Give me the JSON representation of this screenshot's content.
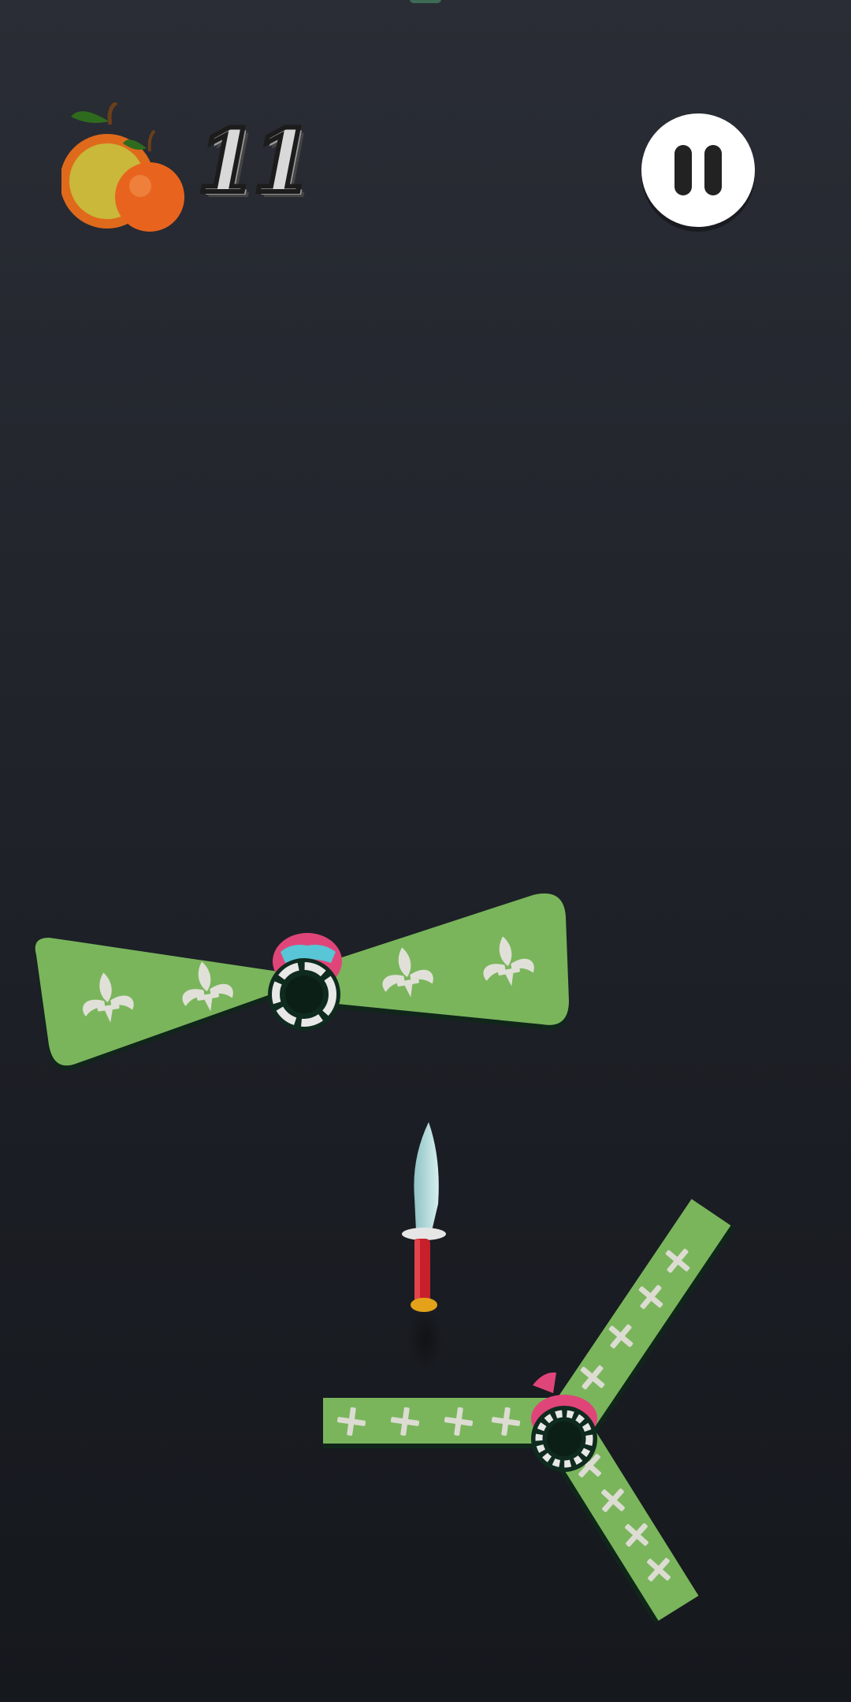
{
  "hud": {
    "fruit_icon": "apple-and-orange-icon",
    "fruit_count": "11",
    "pause_icon": "pause-icon"
  },
  "colors": {
    "background_top": "#2a2d35",
    "background_bottom": "#15181d",
    "target_green": "#7ab55c",
    "hub_pink": "#e0457a",
    "knife_handle": "#c8202a",
    "knife_blade": "#b9dcdc"
  },
  "scene": {
    "targets": [
      {
        "name": "bowtie-spinner",
        "pattern": "fleur-de-lis"
      },
      {
        "name": "tri-blade-spinner",
        "pattern": "cross"
      }
    ],
    "player_item": "knife"
  }
}
